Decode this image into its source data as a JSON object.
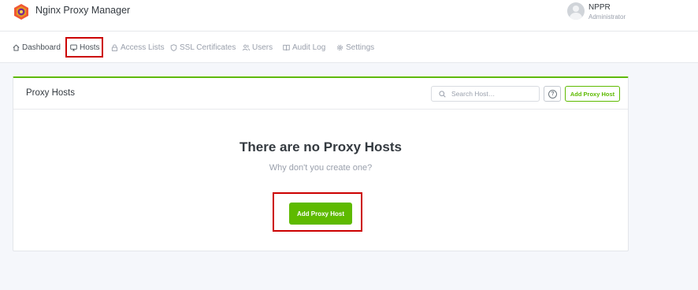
{
  "app": {
    "title": "Nginx Proxy Manager"
  },
  "user": {
    "name": "NPPR",
    "role": "Administrator"
  },
  "nav": {
    "items": [
      {
        "label": "Dashboard",
        "icon": "home-icon",
        "active": false
      },
      {
        "label": "Hosts",
        "icon": "monitor-icon",
        "active": true
      },
      {
        "label": "Access Lists",
        "icon": "lock-icon",
        "active": false
      },
      {
        "label": "SSL Certificates",
        "icon": "shield-icon",
        "active": false
      },
      {
        "label": "Users",
        "icon": "users-icon",
        "active": false
      },
      {
        "label": "Audit Log",
        "icon": "book-icon",
        "active": false
      },
      {
        "label": "Settings",
        "icon": "gear-icon",
        "active": false
      }
    ]
  },
  "card": {
    "title": "Proxy Hosts",
    "search_placeholder": "Search Host…",
    "help_label": "?",
    "add_button_label": "Add Proxy Host"
  },
  "empty_state": {
    "title": "There are no Proxy Hosts",
    "subtitle": "Why don't you create one?",
    "button_label": "Add Proxy Host"
  },
  "colors": {
    "accent": "#5eba00",
    "highlight": "#cc0000",
    "text": "#495057",
    "muted": "#9aa0ac"
  }
}
